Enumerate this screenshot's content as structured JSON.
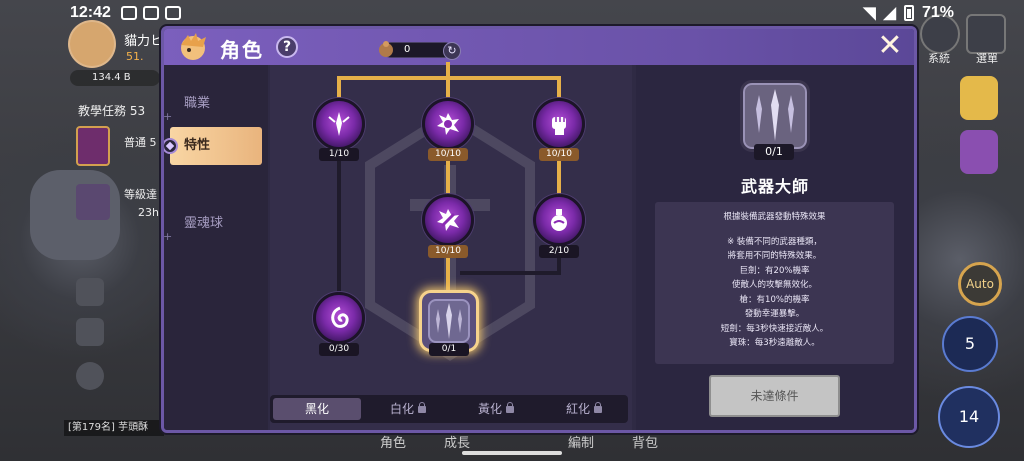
{
  "status_bar": {
    "time": "12:42",
    "battery": "71%"
  },
  "background": {
    "player_name": "貓力ヒ",
    "power": "51.",
    "gold": "134.4 B",
    "tutorial_task": "教學任務 53",
    "task_normal": "普通 5",
    "task_level": "等級達",
    "timer": "23h",
    "ranking": "[第179名] 芋頭酥",
    "system_label": "系統",
    "menu_label": "選單",
    "auto_label": "Auto",
    "skill_1": "5",
    "skill_2": "14",
    "bottom_nav": [
      "角色",
      "成長",
      "編制",
      "背包"
    ]
  },
  "modal": {
    "title": "角色",
    "help": "?",
    "close": "✕",
    "nav": [
      {
        "label": "職業",
        "active": false
      },
      {
        "label": "特性",
        "active": true
      },
      {
        "label": "靈魂球",
        "active": false
      }
    ],
    "counter_value": "0",
    "nodes": [
      {
        "level": "1/10",
        "icon": "sword-burst-icon",
        "maxed": false
      },
      {
        "level": "10/10",
        "icon": "shatter-icon",
        "maxed": true
      },
      {
        "level": "10/10",
        "icon": "fist-icon",
        "maxed": true
      },
      {
        "level": "10/10",
        "icon": "shield-crack-icon",
        "maxed": true
      },
      {
        "level": "2/10",
        "icon": "potion-icon",
        "maxed": false
      },
      {
        "level": "0/30",
        "icon": "spirit-orb-icon",
        "maxed": false
      },
      {
        "level": "0/1",
        "icon": "weapon-master-icon",
        "maxed": false
      }
    ],
    "tabs": [
      {
        "label": "黑化",
        "locked": false
      },
      {
        "label": "白化",
        "locked": true
      },
      {
        "label": "黃化",
        "locked": true
      },
      {
        "label": "紅化",
        "locked": true
      }
    ],
    "detail": {
      "level": "0/1",
      "title": "武器大師",
      "desc_intro": "根據裝備武器發動特殊效果",
      "desc_lines": [
        "※ 裝備不同的武器種類，",
        "將套用不同的特殊效果。",
        "巨劍：有20%機率",
        "使敵人的攻擊無效化。",
        "槍：有10%的機率",
        "發動幸運暴擊。",
        "短劍：每3秒快速接近敵人。",
        "寶珠：每3秒遠離敵人。"
      ],
      "button": "未達條件"
    }
  },
  "colors": {
    "accent_gold": "#e6b049",
    "panel_purple": "#2f2a44",
    "header_purple": "#7b5fbd",
    "node_purple": "#b34ed6"
  }
}
